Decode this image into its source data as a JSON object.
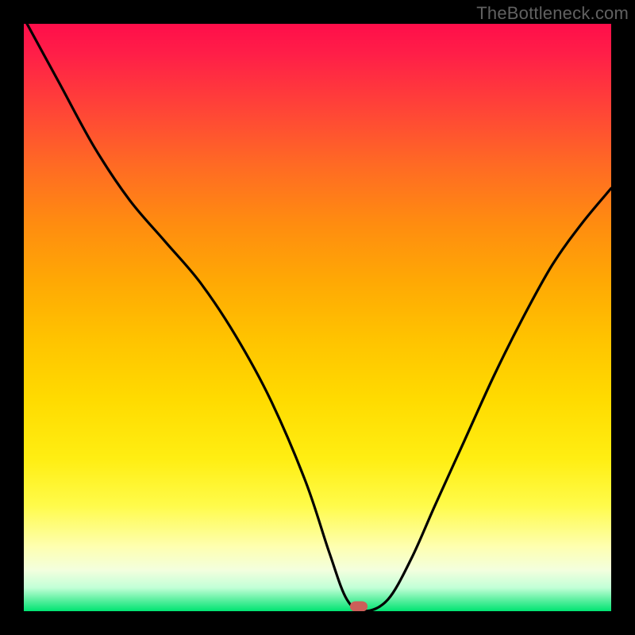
{
  "watermark": "TheBottleneck.com",
  "marker": {
    "x_pct": 57,
    "y_pct": 99.2,
    "color": "#cc5f59"
  },
  "chart_data": {
    "type": "line",
    "title": "",
    "xlabel": "",
    "ylabel": "",
    "xlim": [
      0,
      100
    ],
    "ylim": [
      0,
      100
    ],
    "grid": false,
    "series": [
      {
        "name": "bottleneck-curve",
        "x": [
          0,
          6,
          12,
          18,
          24,
          30,
          36,
          42,
          48,
          52,
          55,
          58,
          62,
          66,
          70,
          75,
          80,
          85,
          90,
          95,
          100
        ],
        "values": [
          101,
          90,
          79,
          70,
          63,
          56,
          47,
          36,
          22,
          10,
          2,
          0,
          2,
          9,
          18,
          29,
          40,
          50,
          59,
          66,
          72
        ]
      }
    ],
    "background_gradient_stops": [
      {
        "pct": 0,
        "color": "#ff0e4a"
      },
      {
        "pct": 14,
        "color": "#ff4238"
      },
      {
        "pct": 34,
        "color": "#ff8c10"
      },
      {
        "pct": 54,
        "color": "#ffc400"
      },
      {
        "pct": 74,
        "color": "#ffee12"
      },
      {
        "pct": 89,
        "color": "#feffb0"
      },
      {
        "pct": 96,
        "color": "#c2ffd7"
      },
      {
        "pct": 100,
        "color": "#00e472"
      }
    ],
    "notes": "Values are percentages of plot height from bottom (0) to top (100). The single curve descends from top-left, flattens near x≈55–58 at value 0, then rises toward the right edge reaching ≈72 at x=100. A small rounded marker sits at the trough."
  }
}
